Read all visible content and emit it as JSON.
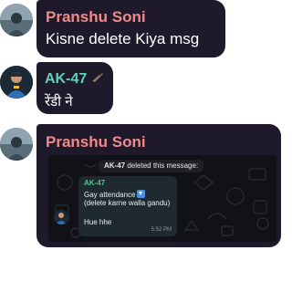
{
  "colors": {
    "bubble_bg": "#1e1a2c",
    "pranshu_name": "#f08a8a",
    "ak_name": "#5ed1b8",
    "quoted_name": "#47c98a"
  },
  "messages": [
    {
      "sender": "Pranshu Soni",
      "text": "Kisne delete Kiya msg"
    },
    {
      "sender": "AK-47",
      "text": "रेंडी ने"
    },
    {
      "sender": "Pranshu Soni",
      "forwarded": {
        "system_sender": "AK-47",
        "system_text": " deleted this message:",
        "quoted_sender": "AK-47",
        "quoted_line1": "Gay attendance",
        "quoted_line2": "(delete karne walla gandu)",
        "quoted_line3": "Hue hhe",
        "quoted_time": "5:52 PM"
      }
    }
  ]
}
